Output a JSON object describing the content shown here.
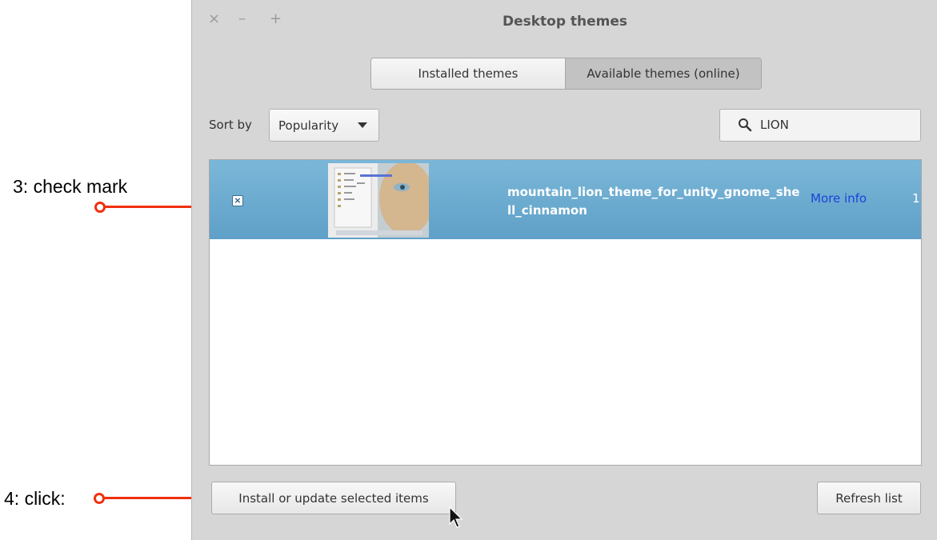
{
  "annotations": {
    "step3": "3: check mark",
    "step4": "4: click:"
  },
  "window": {
    "title": "Desktop themes",
    "controls": {
      "close": "×",
      "minimize": "–",
      "maximize": "+"
    }
  },
  "tabs": [
    {
      "label": "Installed themes",
      "selected": false
    },
    {
      "label": "Available themes (online)",
      "selected": true
    }
  ],
  "sort": {
    "label": "Sort by",
    "value": "Popularity"
  },
  "search": {
    "value": "LION",
    "icon": "search-icon"
  },
  "list": {
    "items": [
      {
        "name": "mountain_lion_theme_for_unity_gnome_shell_cinnamon",
        "checked": true,
        "more_info": "More info",
        "count": "1"
      }
    ]
  },
  "buttons": {
    "install": "Install or update selected items",
    "refresh": "Refresh list"
  },
  "colors": {
    "selection": "#6aa9cf",
    "annotation_arrow": "#f0300f",
    "link": "#1b43d9"
  }
}
